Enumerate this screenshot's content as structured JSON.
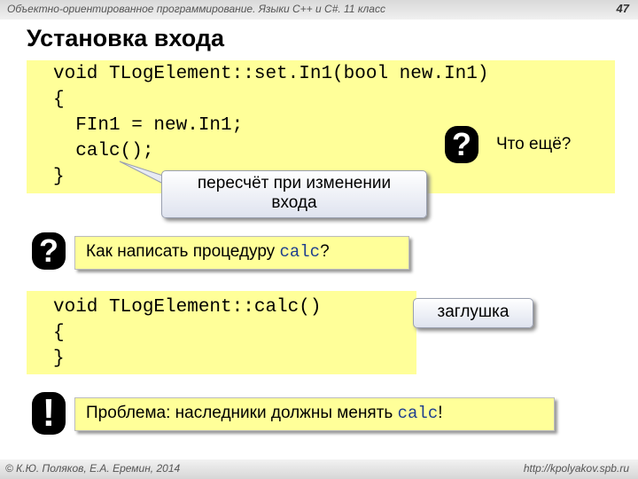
{
  "header": {
    "course": "Объектно-ориентированное программирование. Языки C++ и C#. 11 класс",
    "page": "47"
  },
  "title": "Установка входа",
  "code1": {
    "line1": "void TLogElement::set.In1(bool new.In1)",
    "line2": "{",
    "line3": "  FIn1 = new.In1;",
    "line4": "  calc();",
    "line5": "}"
  },
  "q1": {
    "mark": "?",
    "text": "Что ещё?"
  },
  "callout1": {
    "line1": "пересчёт при изменении",
    "line2": "входа"
  },
  "q2": {
    "mark": "?",
    "text_before": "Как написать процедуру ",
    "code": "calc",
    "text_after": "?"
  },
  "code2": {
    "line1": "void TLogElement::calc()",
    "line2": "{",
    "line3": "}"
  },
  "callout2": {
    "text": "заглушка"
  },
  "note": {
    "mark": "!",
    "text_before": "Проблема: наследники должны менять ",
    "code": "calc",
    "text_after": "!"
  },
  "footer": {
    "authors": "© К.Ю. Поляков, Е.А. Еремин, 2014",
    "url": "http://kpolyakov.spb.ru"
  }
}
